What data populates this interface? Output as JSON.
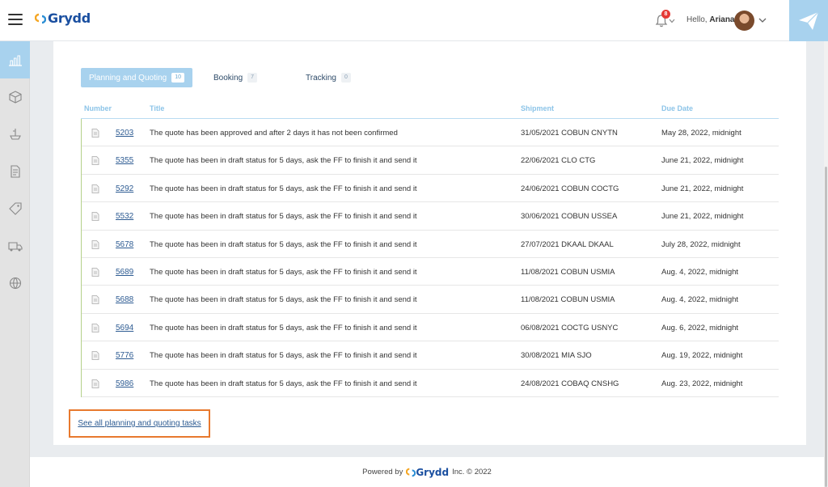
{
  "app": {
    "logo_text": "Grydd"
  },
  "header": {
    "greeting_prefix": "Hello, ",
    "user_name": "Ariana",
    "notification_count": "8",
    "icons": [
      "menu-icon",
      "bell-icon",
      "chevron-down-icon",
      "paper-plane-icon"
    ]
  },
  "sidebar": {
    "items": [
      {
        "icon": "chart-icon",
        "active": true
      },
      {
        "icon": "box-icon",
        "active": false
      },
      {
        "icon": "ship-icon",
        "active": false
      },
      {
        "icon": "document-icon",
        "active": false
      },
      {
        "icon": "tag-icon",
        "active": false
      },
      {
        "icon": "truck-icon",
        "active": false
      },
      {
        "icon": "globe-icon",
        "active": false
      }
    ]
  },
  "tabs": [
    {
      "label": "Planning and Quoting",
      "count": "10",
      "active": true
    },
    {
      "label": "Booking",
      "count": "7",
      "active": false
    },
    {
      "label": "Tracking",
      "count": "0",
      "active": false
    }
  ],
  "table": {
    "columns": [
      "Number",
      "Title",
      "Shipment",
      "Due Date"
    ],
    "rows": [
      {
        "number": "5203",
        "title": "The quote has been approved and after 2 days it has not been confirmed",
        "shipment": "31/05/2021 COBUN CNYTN",
        "due": "May 28, 2022, midnight"
      },
      {
        "number": "5355",
        "title": "The quote has been in draft status for 5 days, ask the FF to finish it and send it",
        "shipment": "22/06/2021 CLO CTG",
        "due": "June 21, 2022, midnight"
      },
      {
        "number": "5292",
        "title": "The quote has been in draft status for 5 days, ask the FF to finish it and send it",
        "shipment": "24/06/2021 COBUN COCTG",
        "due": "June 21, 2022, midnight"
      },
      {
        "number": "5532",
        "title": "The quote has been in draft status for 5 days, ask the FF to finish it and send it",
        "shipment": "30/06/2021 COBUN USSEA",
        "due": "June 21, 2022, midnight"
      },
      {
        "number": "5678",
        "title": "The quote has been in draft status for 5 days, ask the FF to finish it and send it",
        "shipment": "27/07/2021 DKAAL DKAAL",
        "due": "July 28, 2022, midnight"
      },
      {
        "number": "5689",
        "title": "The quote has been in draft status for 5 days, ask the FF to finish it and send it",
        "shipment": "11/08/2021 COBUN USMIA",
        "due": "Aug. 4, 2022, midnight"
      },
      {
        "number": "5688",
        "title": "The quote has been in draft status for 5 days, ask the FF to finish it and send it",
        "shipment": "11/08/2021 COBUN USMIA",
        "due": "Aug. 4, 2022, midnight"
      },
      {
        "number": "5694",
        "title": "The quote has been in draft status for 5 days, ask the FF to finish it and send it",
        "shipment": "06/08/2021 COCTG USNYC",
        "due": "Aug. 6, 2022, midnight"
      },
      {
        "number": "5776",
        "title": "The quote has been in draft status for 5 days, ask the FF to finish it and send it",
        "shipment": "30/08/2021 MIA SJO",
        "due": "Aug. 19, 2022, midnight"
      },
      {
        "number": "5986",
        "title": "The quote has been in draft status for 5 days, ask the FF to finish it and send it",
        "shipment": "24/08/2021 COBAQ CNSHG",
        "due": "Aug. 23, 2022, midnight"
      }
    ]
  },
  "see_all_link": "See all planning and quoting tasks",
  "footer": {
    "prefix": "Powered by",
    "brand": "Grydd",
    "suffix": "Inc. © 2022"
  },
  "colors": {
    "accent": "#a8d2ee",
    "link": "#2d5b92",
    "header_text": "#8cc4e8",
    "highlight_border": "#e8792e",
    "logo": "#1a4fa0"
  }
}
